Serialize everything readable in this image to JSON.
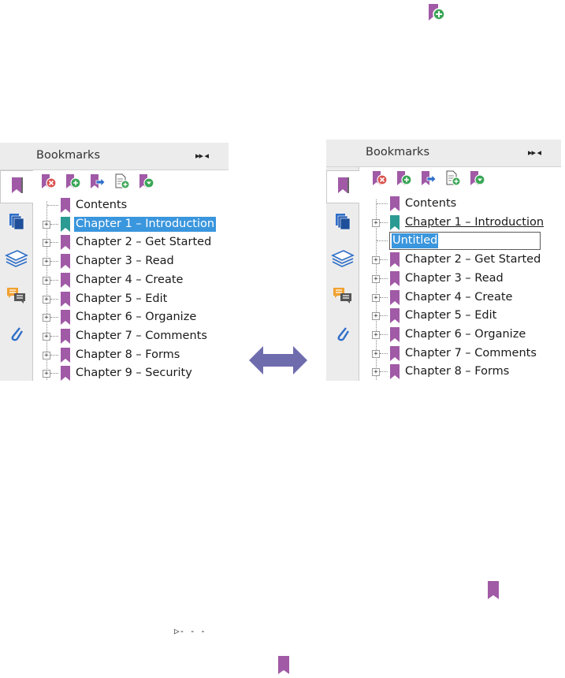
{
  "top_icon": "add-bookmark-icon",
  "colors": {
    "bookmark_purple": "#a05aa6",
    "bookmark_teal": "#2b9a93",
    "selection_blue": "#3a96dd",
    "arrow_purple": "#6f6cae",
    "delete_red": "#d9534f",
    "add_green": "#3aa655",
    "move_blue": "#2f6fc9"
  },
  "left_panel": {
    "title": "Bookmarks",
    "controls": "▸▸ ◂",
    "toolbar": [
      "delete-bookmark-icon",
      "add-bookmark-icon",
      "move-bookmark-icon",
      "new-bookmark-from-page-icon",
      "expand-bookmark-icon"
    ],
    "side_tabs": [
      "bookmarks-panel-icon",
      "pages-panel-icon",
      "layers-panel-icon",
      "comments-panel-icon",
      "attachments-panel-icon"
    ],
    "items": [
      {
        "label": "Contents",
        "expandable": false,
        "color": "purple",
        "state": "normal"
      },
      {
        "label": "Chapter 1 – Introduction",
        "expandable": true,
        "color": "teal",
        "state": "selected"
      },
      {
        "label": "Chapter 2 – Get Started",
        "expandable": true,
        "color": "purple",
        "state": "normal"
      },
      {
        "label": "Chapter 3 – Read",
        "expandable": true,
        "color": "purple",
        "state": "normal"
      },
      {
        "label": "Chapter 4 – Create",
        "expandable": true,
        "color": "purple",
        "state": "normal"
      },
      {
        "label": "Chapter 5 – Edit",
        "expandable": true,
        "color": "purple",
        "state": "normal"
      },
      {
        "label": "Chapter 6 – Organize",
        "expandable": true,
        "color": "purple",
        "state": "normal"
      },
      {
        "label": "Chapter 7 – Comments",
        "expandable": true,
        "color": "purple",
        "state": "normal"
      },
      {
        "label": "Chapter 8 – Forms",
        "expandable": true,
        "color": "purple",
        "state": "normal"
      },
      {
        "label": "Chapter 9 – Security",
        "expandable": true,
        "color": "purple",
        "state": "normal"
      }
    ]
  },
  "right_panel": {
    "title": "Bookmarks",
    "controls": "▸▸ ◂",
    "toolbar": [
      "delete-bookmark-icon",
      "add-bookmark-icon",
      "move-bookmark-icon",
      "new-bookmark-from-page-icon",
      "expand-bookmark-icon"
    ],
    "side_tabs": [
      "bookmarks-panel-icon",
      "pages-panel-icon",
      "layers-panel-icon",
      "comments-panel-icon",
      "attachments-panel-icon"
    ],
    "items": [
      {
        "label": "Contents",
        "expandable": false,
        "color": "purple",
        "state": "normal"
      },
      {
        "label": "Chapter 1 – Introduction",
        "expandable": true,
        "color": "teal",
        "state": "underlined"
      },
      {
        "label": "Untitled",
        "expandable": false,
        "color": "none",
        "state": "editing"
      },
      {
        "label": "Chapter 2 – Get Started",
        "expandable": true,
        "color": "purple",
        "state": "normal"
      },
      {
        "label": "Chapter 3 – Read",
        "expandable": true,
        "color": "purple",
        "state": "normal"
      },
      {
        "label": "Chapter 4 – Create",
        "expandable": true,
        "color": "purple",
        "state": "normal"
      },
      {
        "label": "Chapter 5 – Edit",
        "expandable": true,
        "color": "purple",
        "state": "normal"
      },
      {
        "label": "Chapter 6 – Organize",
        "expandable": true,
        "color": "purple",
        "state": "normal"
      },
      {
        "label": "Chapter 7 – Comments",
        "expandable": true,
        "color": "purple",
        "state": "normal"
      },
      {
        "label": "Chapter 8 – Forms",
        "expandable": true,
        "color": "purple",
        "state": "normal"
      }
    ]
  },
  "center_arrow": "double-headed-arrow",
  "bottom": {
    "connector_glyph": "▷- - -",
    "bookmark_icons": [
      "bookmark-icon",
      "bookmark-icon"
    ]
  }
}
